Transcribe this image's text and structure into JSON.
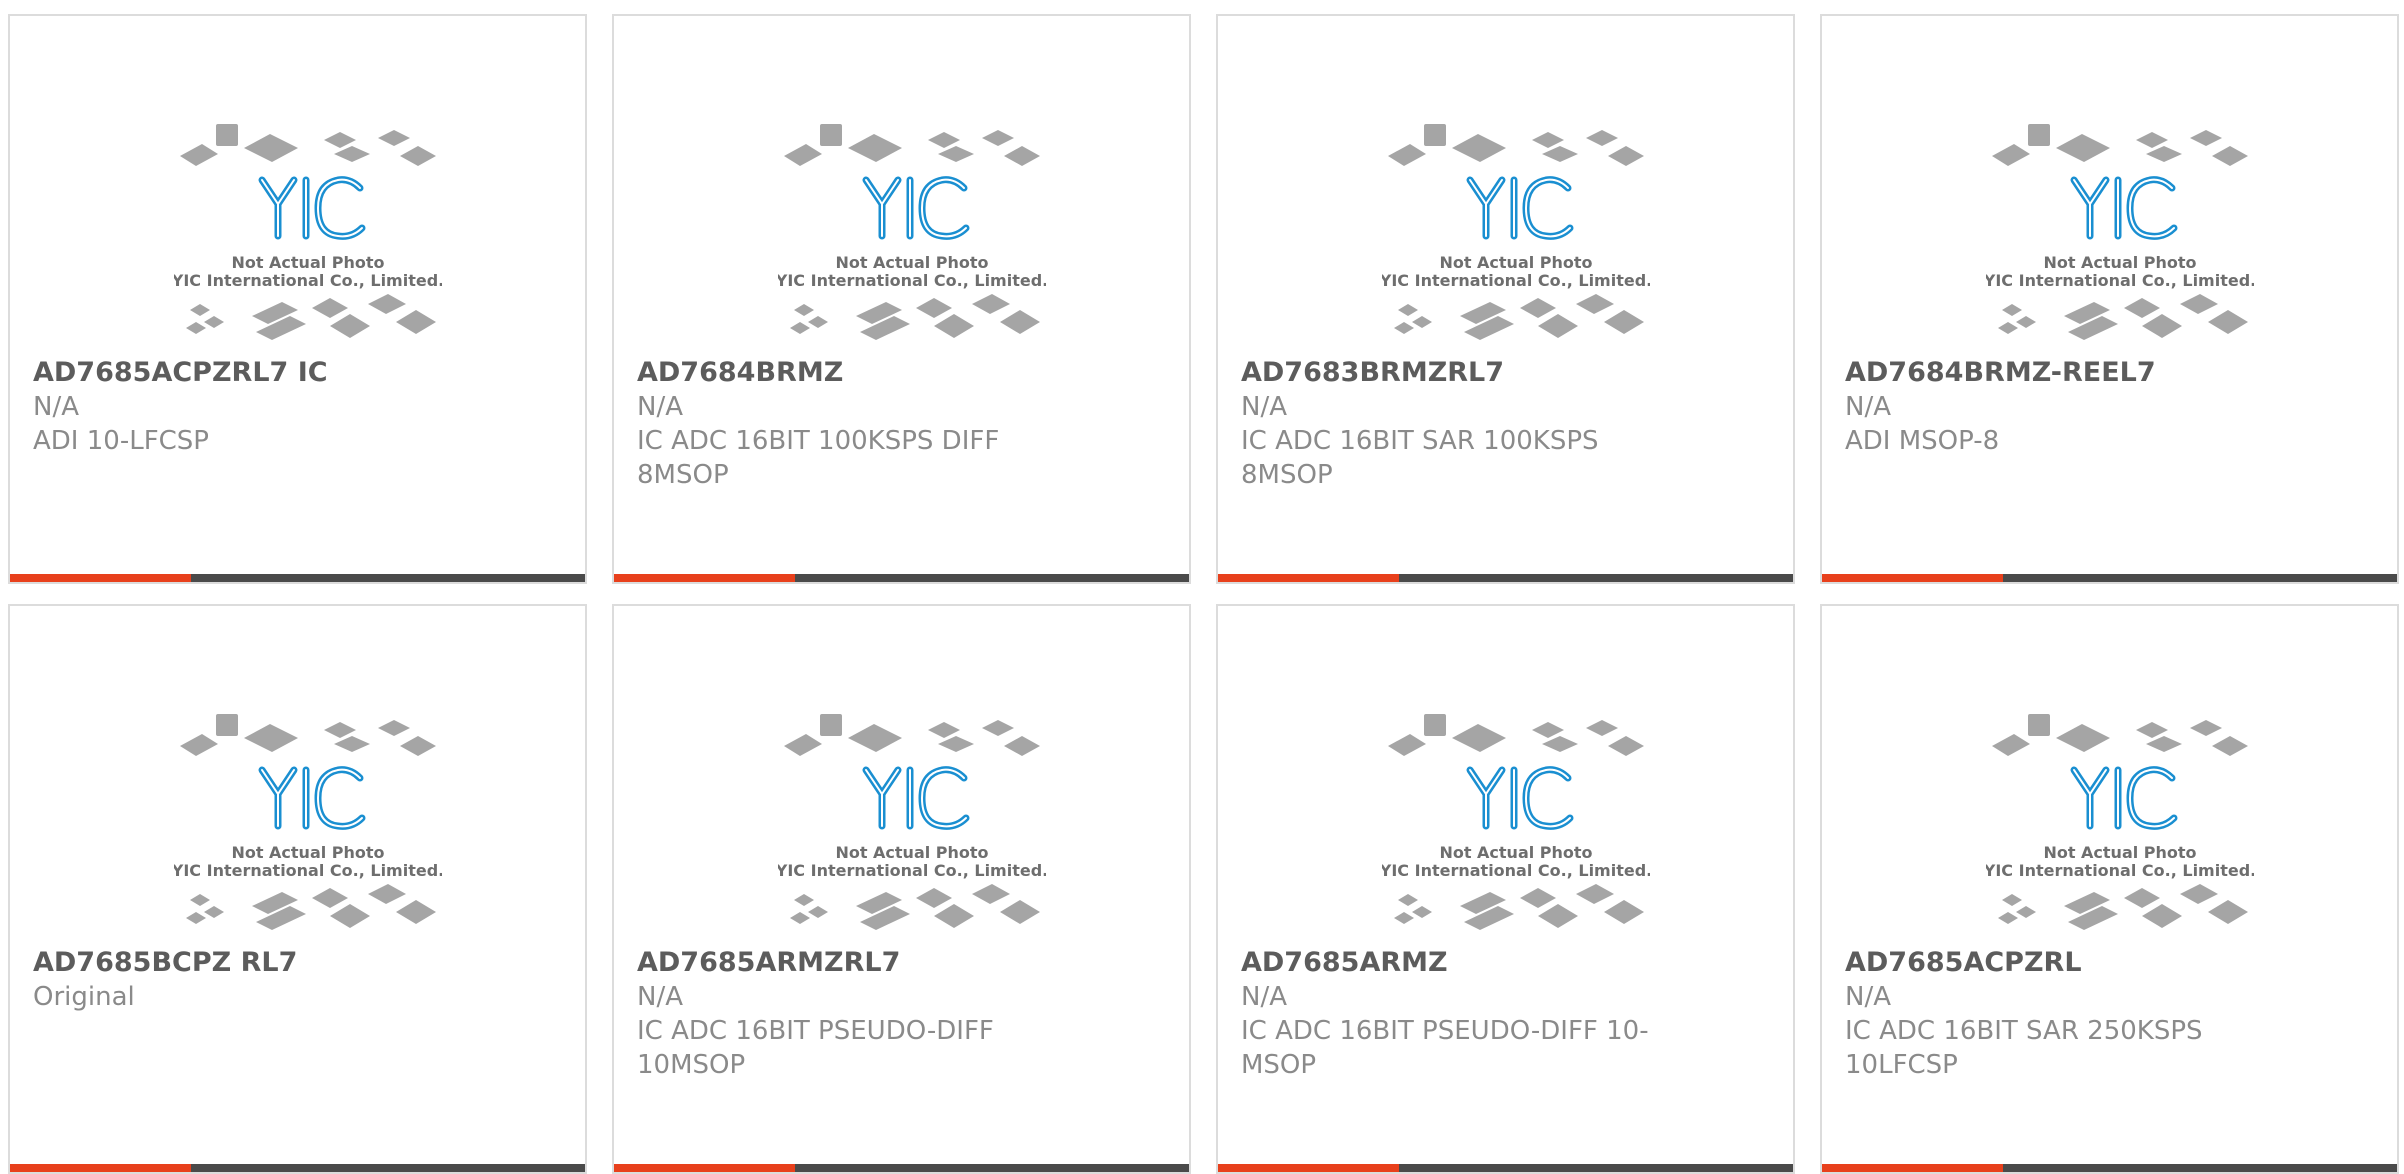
{
  "theme": {
    "accent": "#e8401c",
    "bar_dark": "#4a4a4a",
    "logo_blue": "#1a8fd1",
    "logo_dark": "#0d3c6e",
    "chip_gray": "#a5a5a5"
  },
  "placeholder": {
    "icon": "yic-logo-chips-icon",
    "line1": "Not Actual Photo",
    "line2": "YIC International Co., Limited."
  },
  "products": [
    {
      "part": "AD7685ACPZRL7 IC",
      "condition": "N/A",
      "description": "ADI 10-LFCSP"
    },
    {
      "part": "AD7684BRMZ",
      "condition": "N/A",
      "description": "IC ADC 16BIT 100KSPS DIFF 8MSOP"
    },
    {
      "part": "AD7683BRMZRL7",
      "condition": "N/A",
      "description": "IC ADC 16BIT SAR 100KSPS 8MSOP"
    },
    {
      "part": "AD7684BRMZ-REEL7",
      "condition": "N/A",
      "description": "ADI MSOP-8"
    },
    {
      "part": "AD7685BCPZ RL7",
      "condition": "Original",
      "description": ""
    },
    {
      "part": "AD7685ARMZRL7",
      "condition": "N/A",
      "description": "IC ADC 16BIT PSEUDO-DIFF 10MSOP"
    },
    {
      "part": "AD7685ARMZ",
      "condition": "N/A",
      "description": "IC ADC 16BIT PSEUDO-DIFF 10-MSOP"
    },
    {
      "part": "AD7685ACPZRL",
      "condition": "N/A",
      "description": "IC ADC 16BIT SAR 250KSPS 10LFCSP"
    }
  ]
}
